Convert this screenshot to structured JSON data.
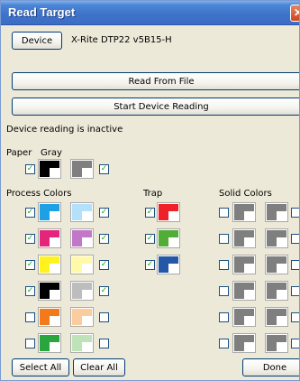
{
  "window": {
    "title": "Read Target",
    "close_glyph": "✕",
    "check_glyph": "✓"
  },
  "device": {
    "button_label": "Device",
    "name": "X-Rite DTP22 v5B15-H"
  },
  "buttons": {
    "read_from_file": "Read From File",
    "start_reading": "Start Device Reading",
    "select_all": "Select All",
    "clear_all": "Clear All",
    "done": "Done"
  },
  "status": "Device reading is inactive",
  "paper_gray": {
    "label_paper": "Paper",
    "label_gray": "Gray",
    "paper": {
      "color": "#000000",
      "inset": "#ffffff",
      "checked": true
    },
    "gray": {
      "color": "#7f7f7f",
      "inset": "#ffffff",
      "checked": true
    }
  },
  "sections": {
    "process": "Process Colors",
    "trap": "Trap",
    "solid": "Solid Colors"
  },
  "process_colors": [
    {
      "name": "cyan",
      "solid": "#1ea0e4",
      "tint": "#b3e1fb",
      "checked_solid": true,
      "checked_tint": true
    },
    {
      "name": "magenta",
      "solid": "#e3267c",
      "tint": "#c278c8",
      "checked_solid": true,
      "checked_tint": true
    },
    {
      "name": "yellow",
      "solid": "#fff21e",
      "tint": "#fff9a8",
      "checked_solid": true,
      "checked_tint": true
    },
    {
      "name": "black",
      "solid": "#000000",
      "tint": "#bdbdbd",
      "checked_solid": true,
      "checked_tint": true
    },
    {
      "name": "orange",
      "solid": "#f27a1a",
      "tint": "#fbcd9e",
      "checked_solid": false,
      "checked_tint": false
    },
    {
      "name": "green",
      "solid": "#2aa63e",
      "tint": "#bfe3b8",
      "checked_solid": false,
      "checked_tint": false
    }
  ],
  "trap_colors": [
    {
      "name": "red",
      "color": "#ee2128",
      "checked": true
    },
    {
      "name": "green",
      "color": "#52ad38",
      "checked": true
    },
    {
      "name": "blue",
      "color": "#2457a6",
      "checked": true
    }
  ],
  "solid_colors": [
    {
      "left": "#7f7f7f",
      "right": "#7f7f7f",
      "checked_left": false,
      "checked_right": false
    },
    {
      "left": "#7f7f7f",
      "right": "#7f7f7f",
      "checked_left": false,
      "checked_right": false
    },
    {
      "left": "#7f7f7f",
      "right": "#7f7f7f",
      "checked_left": false,
      "checked_right": false
    },
    {
      "left": "#7f7f7f",
      "right": "#7f7f7f",
      "checked_left": false,
      "checked_right": false
    },
    {
      "left": "#7f7f7f",
      "right": "#7f7f7f",
      "checked_left": false,
      "checked_right": false
    },
    {
      "left": "#7f7f7f",
      "right": "#7f7f7f",
      "checked_left": false,
      "checked_right": false
    }
  ]
}
